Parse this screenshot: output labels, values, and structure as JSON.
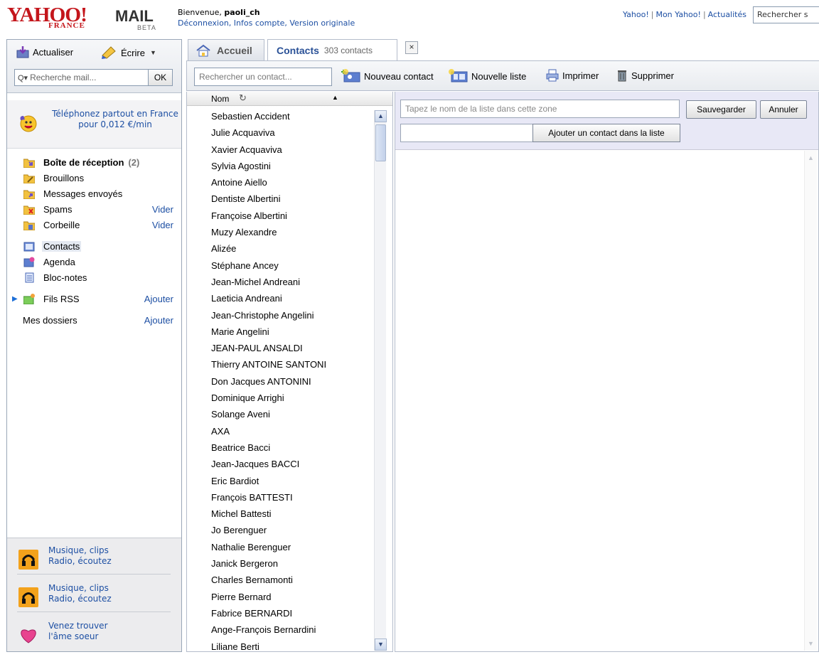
{
  "header": {
    "logo_yahoo": "YAHOO!",
    "logo_france": "FRANCE",
    "logo_mail": "MAIL",
    "logo_beta": "BETA",
    "welcome_prefix": "Bienvenue, ",
    "username": "paoli_ch",
    "account_links": "Déconnexion, Infos compte, Version originale",
    "top_links": [
      "Yahoo!",
      "Mon Yahoo!",
      "Actualités"
    ],
    "top_search_placeholder": "Rechercher s"
  },
  "left": {
    "refresh_label": "Actualiser",
    "compose_label": "Écrire",
    "mail_search_placeholder": "Recherche mail...",
    "ok_label": "OK",
    "promo_top": "Téléphonez partout en France pour 0,012 €/min",
    "folders": [
      {
        "label": "Boîte de réception",
        "count": "(2)",
        "action": ""
      },
      {
        "label": "Brouillons",
        "count": "",
        "action": ""
      },
      {
        "label": "Messages envoyés",
        "count": "",
        "action": ""
      },
      {
        "label": "Spams",
        "count": "",
        "action": "Vider"
      },
      {
        "label": "Corbeille",
        "count": "",
        "action": "Vider"
      },
      {
        "label": "Contacts",
        "count": "",
        "action": ""
      },
      {
        "label": "Agenda",
        "count": "",
        "action": ""
      },
      {
        "label": "Bloc-notes",
        "count": "",
        "action": ""
      },
      {
        "label": "Fils RSS",
        "count": "",
        "action": "Ajouter"
      }
    ],
    "my_folders_label": "Mes dossiers",
    "my_folders_action": "Ajouter",
    "promos_bottom": [
      {
        "line1": "Musique, clips",
        "line2": "Radio, écoutez"
      },
      {
        "line1": "Musique, clips",
        "line2": "Radio, écoutez"
      },
      {
        "line1": "Venez trouver",
        "line2": "l'âme soeur"
      }
    ]
  },
  "tabs": {
    "home_label": "Accueil",
    "contacts_label": "Contacts",
    "contacts_count": "303 contacts",
    "close_label": "×"
  },
  "toolbar": {
    "contact_search_placeholder": "Rechercher un contact...",
    "new_contact": "Nouveau contact",
    "new_list": "Nouvelle liste",
    "print": "Imprimer",
    "delete": "Supprimer"
  },
  "contact_list": {
    "column_header": "Nom",
    "contacts": [
      "Sebastien Accident",
      "Julie Acquaviva",
      "Xavier Acquaviva",
      "Sylvia Agostini",
      "Antoine Aiello",
      "Dentiste Albertini",
      "Françoise Albertini",
      "Muzy Alexandre",
      "Alizée",
      "Stéphane Ancey",
      "Jean-Michel Andreani",
      "Laeticia Andreani",
      "Jean-Christophe Angelini",
      "Marie Angelini",
      "JEAN-PAUL ANSALDI",
      "Thierry ANTOINE SANTONI",
      "Don Jacques ANTONINI",
      "Dominique Arrighi",
      "Solange Aveni",
      "AXA",
      "Beatrice Bacci",
      "Jean-Jacques BACCI",
      "Eric Bardiot",
      "François BATTESTI",
      "Michel Battesti",
      "Jo Berenguer",
      "Nathalie Berenguer",
      "Janick Bergeron",
      "Charles Bernamonti",
      "Pierre Bernard",
      "Fabrice BERNARDI",
      "Ange-François Bernardini",
      "Liliane Berti"
    ]
  },
  "list_editor": {
    "name_placeholder": "Tapez le nom de la liste dans cette zone",
    "save_label": "Sauvegarder",
    "cancel_label": "Annuler",
    "add_contact_label": "Ajouter un contact dans la liste"
  },
  "colors": {
    "link": "#1d4fa3",
    "brand_red": "#c4161c",
    "editor_bg": "#e8e8f6"
  }
}
